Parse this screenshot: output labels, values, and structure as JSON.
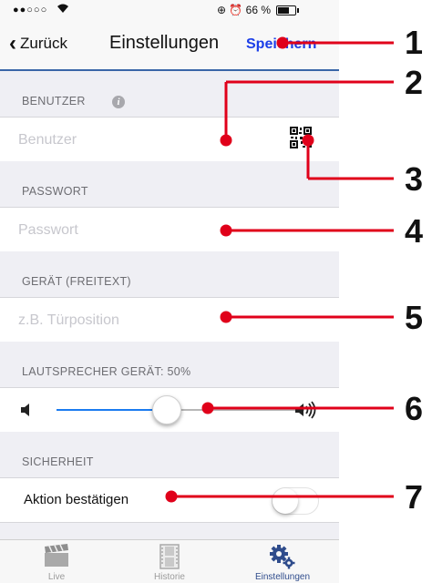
{
  "status_bar": {
    "signal": "●●○○○",
    "wifi_icon": "wifi-icon",
    "right_text": "⊕ ⏰ 66 %",
    "battery_level": 0.66
  },
  "nav": {
    "back_label": "Zurück",
    "title": "Einstellungen",
    "save_label": "Speichern",
    "save_color": "#1b3ee8"
  },
  "sections": {
    "user": {
      "header": "BENUTZER",
      "placeholder": "Benutzer",
      "value": ""
    },
    "password": {
      "header": "PASSWORT",
      "placeholder": "Passwort",
      "value": ""
    },
    "device": {
      "header": "GERÄT (FREITEXT)",
      "placeholder": "z.B. Türposition",
      "value": ""
    },
    "speaker": {
      "header": "LAUTSPRECHER GERÄT: 50%",
      "level": 0.5
    },
    "security": {
      "header": "SICHERHEIT",
      "toggle_label": "Aktion bestätigen",
      "toggle_on": false
    }
  },
  "tabs": [
    {
      "label": "Live",
      "icon": "clapperboard-icon",
      "active": false
    },
    {
      "label": "Historie",
      "icon": "film-icon",
      "active": false
    },
    {
      "label": "Einstellungen",
      "icon": "gears-icon",
      "active": true
    }
  ],
  "annotations": [
    "1",
    "2",
    "3",
    "4",
    "5",
    "6",
    "7"
  ],
  "colors": {
    "accent": "#1b7bf0",
    "annotation": "#e0001a",
    "nav_border": "#3a66a8"
  }
}
